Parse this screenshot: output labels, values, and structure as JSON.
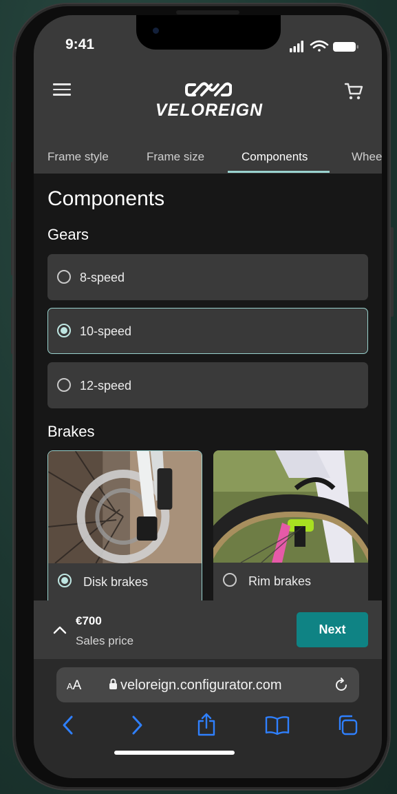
{
  "status": {
    "time": "9:41"
  },
  "header": {
    "brand_name": "VELOREIGN"
  },
  "tabs": [
    {
      "label": "Frame style",
      "active": false
    },
    {
      "label": "Frame size",
      "active": false
    },
    {
      "label": "Components",
      "active": true
    },
    {
      "label": "Whee",
      "active": false
    }
  ],
  "page": {
    "title": "Components",
    "gears": {
      "heading": "Gears",
      "options": [
        {
          "label": "8-speed",
          "selected": false
        },
        {
          "label": "10-speed",
          "selected": true
        },
        {
          "label": "12-speed",
          "selected": false
        }
      ]
    },
    "brakes": {
      "heading": "Brakes",
      "options": [
        {
          "label": "Disk brakes",
          "selected": true
        },
        {
          "label": "Rim brakes",
          "selected": false
        }
      ]
    }
  },
  "footer": {
    "price": "€700",
    "price_label": "Sales price",
    "next_label": "Next"
  },
  "browser": {
    "text_size_label_big": "A",
    "text_size_label_small": "A",
    "url": "veloreign.configurator.com"
  },
  "colors": {
    "accent": "#9ad3cf",
    "button": "#0f8384",
    "surface": "#3a3a3a",
    "background": "#171717",
    "ios_blue": "#2f80ff"
  },
  "icons": [
    "hamburger-menu-icon",
    "brand-logo-icon",
    "cart-icon",
    "chevron-up-icon",
    "lock-icon",
    "reload-icon",
    "back-icon",
    "forward-icon",
    "share-icon",
    "bookmarks-icon",
    "tabs-icon"
  ]
}
